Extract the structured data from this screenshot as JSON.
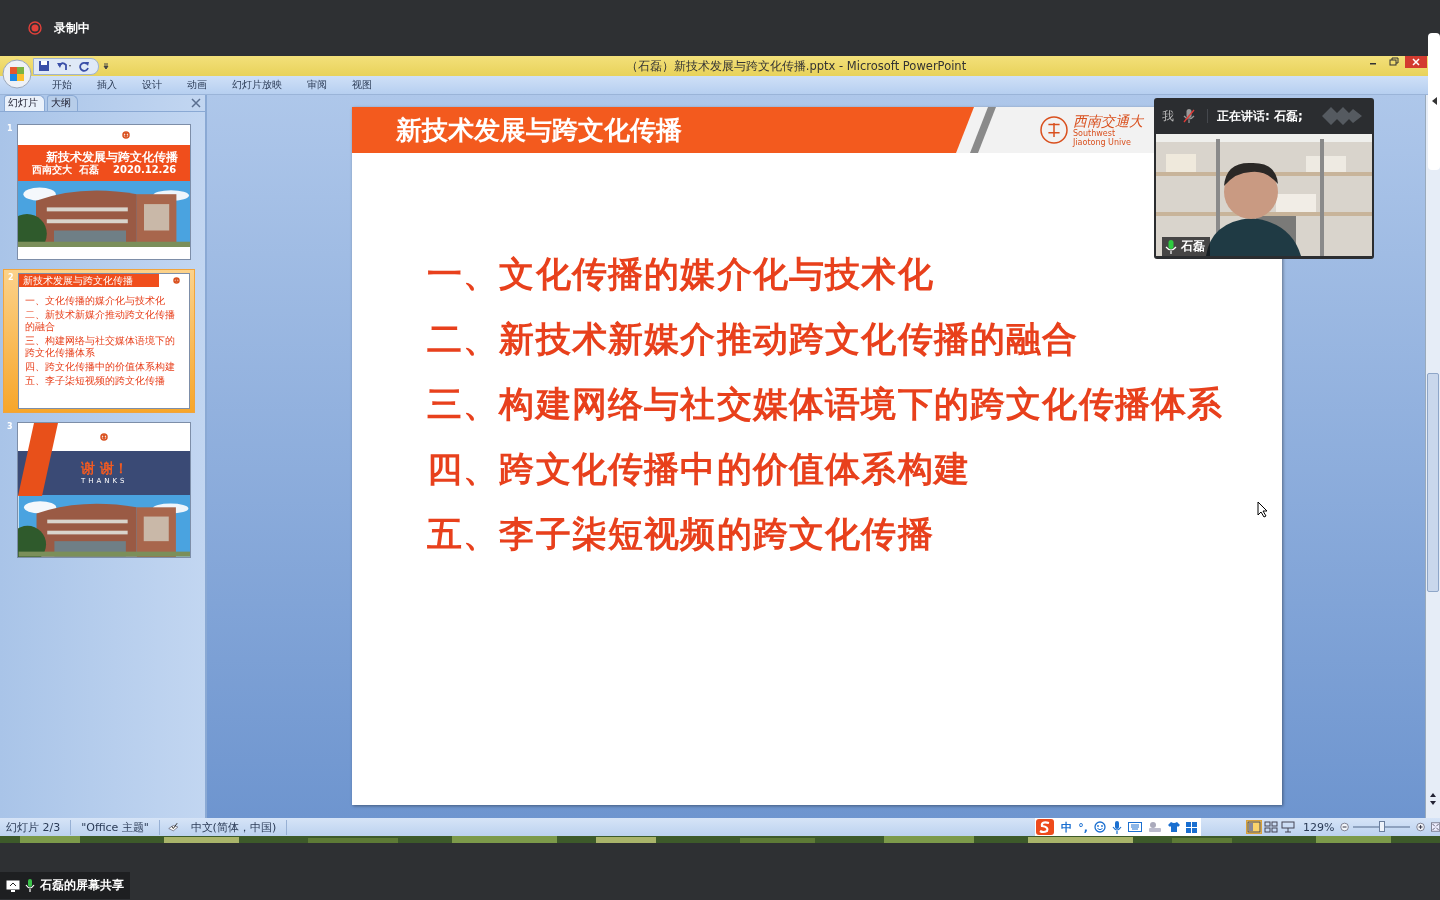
{
  "recording": {
    "label": "录制中"
  },
  "window": {
    "title": "（石磊）新技术发展与跨文化传播.pptx - Microsoft PowerPoint"
  },
  "ribbon_tabs": [
    {
      "label": "开始",
      "selected": false
    },
    {
      "label": "插入",
      "selected": false
    },
    {
      "label": "设计",
      "selected": false
    },
    {
      "label": "动画",
      "selected": false
    },
    {
      "label": "幻灯片放映",
      "selected": false
    },
    {
      "label": "审阅",
      "selected": false
    },
    {
      "label": "视图",
      "selected": false
    }
  ],
  "panel_tabs": [
    {
      "label": "幻灯片",
      "selected": true
    },
    {
      "label": "大纲",
      "selected": false
    }
  ],
  "slides": [
    {
      "number": "1",
      "kind": "title",
      "selected": false,
      "title": "新技术发展与跨文化传播",
      "subtitle": "西南交大  石磊    2020.12.26"
    },
    {
      "number": "2",
      "kind": "contents",
      "selected": true,
      "header": "新技术发展与跨文化传播",
      "items": [
        "一、文化传播的媒介化与技术化",
        "二、新技术新媒介推动跨文化传播的融合",
        "三、构建网络与社交媒体语境下的跨文化传播体系",
        "四、跨文化传播中的价值体系构建",
        "五、李子柒短视频的跨文化传播"
      ]
    },
    {
      "number": "3",
      "kind": "thanks",
      "selected": false,
      "title": "谢 谢！",
      "subtitle": "THANKS"
    }
  ],
  "current_slide": {
    "header": "新技术发展与跨文化传播",
    "logo_text": "西南交通大",
    "logo_subtext": "Southwest Jiaotong Unive",
    "items": [
      "一、文化传播的媒介化与技术化",
      "二、新技术新媒介推动跨文化传播的融合",
      "三、构建网络与社交媒体语境下的跨文化传播体系",
      "四、跨文化传播中的价值体系构建",
      "五、李子柒短视频的跨文化传播"
    ]
  },
  "video": {
    "self_label": "我",
    "speaking": "正在讲话: 石磊;",
    "name": "石磊"
  },
  "status_bar": {
    "slide_info": "幻灯片 2/3",
    "theme": "\"Office 主题\"",
    "language": "中文(简体，中国)",
    "ime_mode": "中",
    "ime_punct": "°,",
    "views": [
      {
        "kind": "normal",
        "selected": true
      },
      {
        "kind": "sorter",
        "selected": false
      },
      {
        "kind": "show",
        "selected": false
      }
    ],
    "zoom": "129%",
    "zoom_slider": {
      "level": 0.52
    }
  },
  "share": {
    "label": "石磊的屏幕共享"
  }
}
